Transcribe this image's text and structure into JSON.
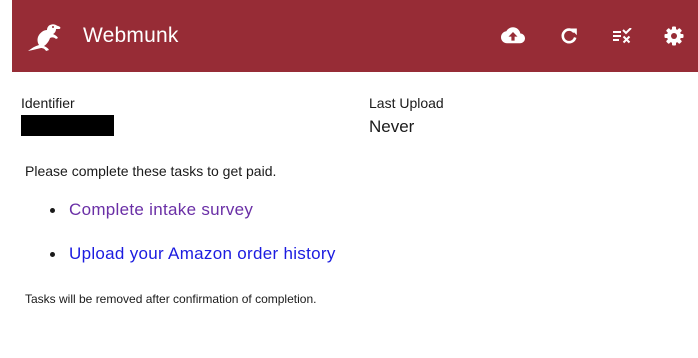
{
  "app": {
    "title": "Webmunk",
    "brand_color": "#972c36"
  },
  "toolbar": {
    "buttons": [
      {
        "name": "upload-icon",
        "label": "Upload"
      },
      {
        "name": "refresh-icon",
        "label": "Refresh"
      },
      {
        "name": "clear-list-icon",
        "label": "Clear tasks"
      },
      {
        "name": "gear-icon",
        "label": "Settings"
      }
    ]
  },
  "identifier": {
    "label": "Identifier",
    "value_redacted": true
  },
  "last_upload": {
    "label": "Last Upload",
    "value": "Never"
  },
  "tasks": {
    "intro": "Please complete these tasks to get paid.",
    "items": [
      {
        "label": "Complete intake survey",
        "visited": true
      },
      {
        "label": "Upload your Amazon order history",
        "visited": false
      }
    ],
    "note": "Tasks will be removed after confirmation of completion."
  }
}
